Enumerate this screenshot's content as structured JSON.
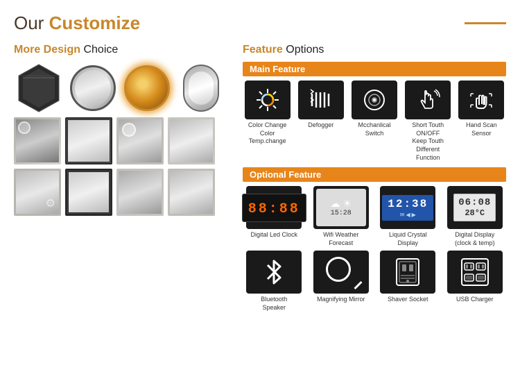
{
  "header": {
    "title_our": "Our ",
    "title_customize": "Customize",
    "line_color": "#c8872a"
  },
  "left": {
    "section_title_design": "More Design",
    "section_title_choice": " Choice",
    "mirror_rows": [
      [
        "hexagon",
        "circle",
        "circle-lit",
        "oval"
      ],
      [
        "rect1",
        "rect2",
        "rect3",
        "rect4"
      ],
      [
        "rect5",
        "rect6",
        "rect7",
        "rect8"
      ]
    ]
  },
  "right": {
    "section_title_feature": "Feature",
    "section_title_options": " Options",
    "main_feature_label": "Main Feature",
    "main_features": [
      {
        "name": "color-change-icon",
        "label": "Color Change\nColor Temp.change",
        "symbol": "☀"
      },
      {
        "name": "defogger-icon",
        "label": "Defogger",
        "symbol": "≡≡≡"
      },
      {
        "name": "switch-icon",
        "label": "Mcchanlical\nSwitch",
        "symbol": "⊙"
      },
      {
        "name": "touch-icon",
        "label": "Short Touth ON/OFF\nKeep Touth Different\nFunction",
        "symbol": "☞"
      },
      {
        "name": "hand-scan-icon",
        "label": "Hand Scan Sensor",
        "symbol": "✋"
      }
    ],
    "optional_feature_label": "Optional Feature",
    "optional_features_row1": [
      {
        "name": "digital-led-clock-icon",
        "label": "Digital Led Clock",
        "display": "clock",
        "text": "88:88"
      },
      {
        "name": "wifi-weather-icon",
        "label": "Wifi Weather Forecast",
        "display": "weather",
        "text": "☁ ☀\n15:28"
      },
      {
        "name": "lcd-icon",
        "label": "Liquid Crystal Display",
        "display": "lcd",
        "text": "12:38"
      },
      {
        "name": "digital-display-icon",
        "label": "Digital Display\n(clock & temp)",
        "display": "digital2",
        "text": "06:08\n28°C"
      }
    ],
    "optional_features_row2": [
      {
        "name": "bluetooth-icon",
        "label": "Bluetooth Speaker",
        "display": "bluetooth"
      },
      {
        "name": "magnify-icon",
        "label": "Magnifying Mirror",
        "display": "magnify"
      },
      {
        "name": "shaver-icon",
        "label": "Shaver Socket",
        "display": "shaver"
      },
      {
        "name": "usb-icon",
        "label": "USB Charger",
        "display": "usb"
      }
    ]
  }
}
